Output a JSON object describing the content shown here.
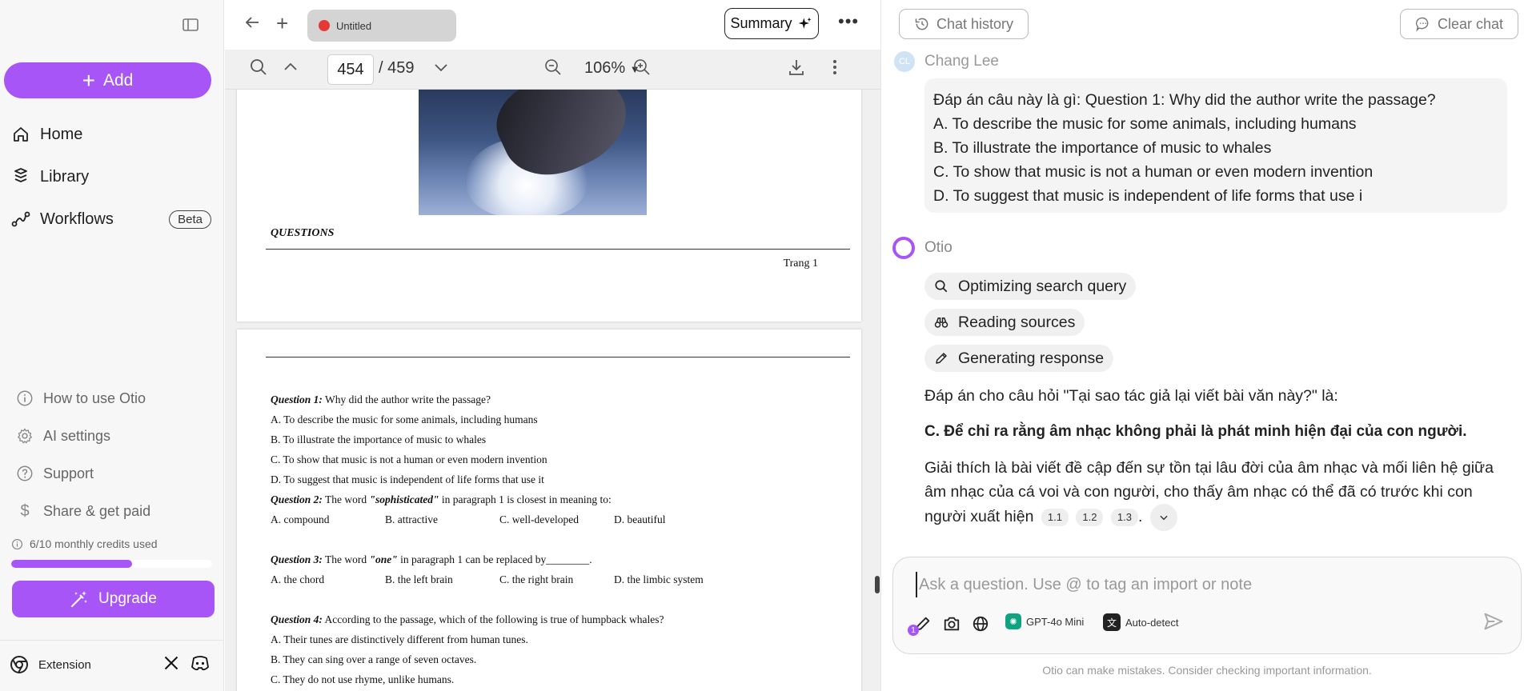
{
  "sidebar": {
    "add_label": "Add",
    "nav": [
      {
        "label": "Home",
        "icon": "home-icon"
      },
      {
        "label": "Library",
        "icon": "library-icon"
      },
      {
        "label": "Workflows",
        "icon": "workflows-icon",
        "badge": "Beta"
      }
    ],
    "links": [
      {
        "label": "How to use Otio",
        "icon": "info-icon"
      },
      {
        "label": "AI settings",
        "icon": "gear-icon"
      },
      {
        "label": "Support",
        "icon": "help-icon"
      },
      {
        "label": "Share & get paid",
        "icon": "dollar-icon"
      }
    ],
    "credits_text": "6/10 monthly credits used",
    "credits_used": 6,
    "credits_total": 10,
    "upgrade_label": "Upgrade",
    "extension_label": "Extension",
    "accent_color": "#a855f7"
  },
  "doc": {
    "tab_title": "Untitled",
    "summary_label": "Summary",
    "page_current": "454",
    "page_total": "/ 459",
    "zoom": "106%",
    "page1": {
      "questions_heading": "QUESTIONS",
      "footer": "Trang 1"
    },
    "page2": {
      "q1_label": "Question 1:",
      "q1_text": " Why did the author write the passage?",
      "q1_a": "A. To describe the music for some animals, including humans",
      "q1_b": "B. To illustrate the importance of music to whales",
      "q1_c": "C. To show that music is not a human or even modern invention",
      "q1_d": "D. To suggest that music is independent of life forms that use it",
      "q2_label": "Question 2:",
      "q2_text_1": " The word ",
      "q2_word": "\"sophisticated\"",
      "q2_text_2": " in paragraph 1 is closest in meaning to:",
      "q2_opts": [
        "A. compound",
        "B. attractive",
        "C. well-developed",
        "D. beautiful"
      ],
      "q3_label": "Question 3:",
      "q3_text_1": " The word ",
      "q3_word": "\"one\"",
      "q3_text_2": " in paragraph 1 can be replaced by________.",
      "q3_opts": [
        "A. the chord",
        "B. the left brain",
        "C. the right brain",
        "D. the limbic system"
      ],
      "q4_label": "Question 4:",
      "q4_text": " According to the passage, which of the following is true of humpback whales?",
      "q4_a": "A. Their tunes are distinctively different from human tunes.",
      "q4_b": "B. They can sing over a range of seven octaves.",
      "q4_c": "C. They do not use rhyme, unlike humans."
    }
  },
  "chat": {
    "history_label": "Chat history",
    "clear_label": "Clear chat",
    "user_name": "Chang Lee",
    "user_initials": "CL",
    "user_message": [
      "Đáp án câu này là gì: Question 1: Why did the author write the passage?",
      "A. To describe the music for some animals, including humans",
      "B. To illustrate the importance of music to whales",
      "C. To show that music is not a human or even modern invention",
      "D. To suggest that music is independent of life forms that use i"
    ],
    "bot_name": "Otio",
    "steps": [
      "Optimizing search query",
      "Reading sources",
      "Generating response"
    ],
    "answer_intro": "Đáp án cho câu hỏi \"Tại sao tác giả lại viết bài văn này?\" là:",
    "answer_bold": "C. Để chỉ ra rằng âm nhạc không phải là phát minh hiện đại của con người.",
    "answer_explain": "Giải thích là bài viết đề cập đến sự tồn tại lâu đời của âm nhạc và mối liên hệ giữa âm nhạc của cá voi và con người, cho thấy âm nhạc có thể đã có trước khi con người xuất hiện",
    "citations": [
      "1.1",
      "1.2",
      "1.3"
    ],
    "input_placeholder": "Ask a question. Use @ to tag an import or note",
    "model": "GPT-4o Mini",
    "language": "Auto-detect",
    "disclaimer": "Otio can make mistakes. Consider checking important information."
  }
}
